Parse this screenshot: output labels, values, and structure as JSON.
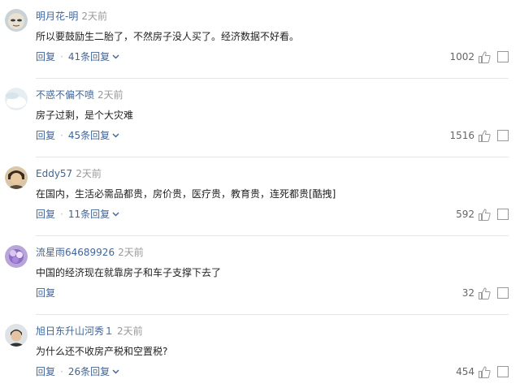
{
  "comments": [
    {
      "name": "明月花-明",
      "time": "2天前",
      "text": "所以要鼓励生二胎了，不然房子没人买了。经济数据不好看。",
      "reply_label": "回复",
      "replies_label": "41条回复",
      "likes": "1002",
      "avatar_icon": "avatar-face-icon"
    },
    {
      "name": "不惑不偏不喷",
      "time": "2天前",
      "text": "房子过剩，是个大灾难",
      "reply_label": "回复",
      "replies_label": "45条回复",
      "likes": "1516",
      "avatar_icon": "avatar-sky-icon"
    },
    {
      "name": "Eddy57",
      "time": "2天前",
      "text": "在国内，生活必需品都贵，房价贵，医疗贵，教育贵，连死都贵[酷拽]",
      "reply_label": "回复",
      "replies_label": "11条回复",
      "likes": "592",
      "avatar_icon": "avatar-person-icon"
    },
    {
      "name": "流星雨64689926",
      "time": "2天前",
      "text": "中国的经济现在就靠房子和车子支撑下去了",
      "reply_label": "回复",
      "replies_label": "",
      "likes": "32",
      "avatar_icon": "avatar-flower-icon"
    },
    {
      "name": "旭日东升山河秀１",
      "time": "2天前",
      "text": "为什么还不收房产税和空置税?",
      "reply_label": "回复",
      "replies_label": "26条回复",
      "likes": "454",
      "avatar_icon": "avatar-man-icon"
    }
  ],
  "colors": {
    "link": "#406599",
    "time": "#999999",
    "divider": "#e6e6e6"
  }
}
